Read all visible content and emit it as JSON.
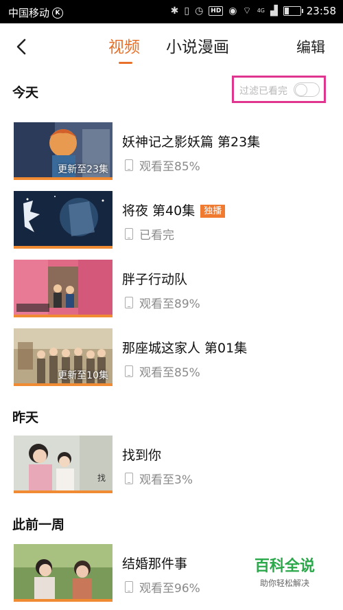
{
  "status_bar": {
    "carrier": "中国移动",
    "carrier_badge": "K",
    "network": "4G",
    "hd": "HD",
    "time": "23:58",
    "battery_level": 0.25
  },
  "header": {
    "tabs": [
      {
        "label": "视频",
        "active": true
      },
      {
        "label": "小说漫画",
        "active": false
      }
    ],
    "edit_label": "编辑",
    "accent_color": "#e8702a"
  },
  "filter": {
    "label": "过滤已看完",
    "enabled": false,
    "highlight_color": "#e0358e"
  },
  "sections": [
    {
      "title": "今天",
      "items": [
        {
          "title": "妖神记之影妖篇 第23集",
          "progress": "观看至85%",
          "thumb_caption": "更新至23集",
          "badge": ""
        },
        {
          "title": "将夜 第40集",
          "progress": "已看完",
          "thumb_caption": "",
          "badge": "独播"
        },
        {
          "title": "胖子行动队",
          "progress": "观看至89%",
          "thumb_caption": "",
          "badge": ""
        },
        {
          "title": "那座城这家人 第01集",
          "progress": "观看至85%",
          "thumb_caption": "更新至10集",
          "badge": ""
        }
      ]
    },
    {
      "title": "昨天",
      "items": [
        {
          "title": "找到你",
          "progress": "观看至3%",
          "thumb_caption": "",
          "badge": ""
        }
      ]
    },
    {
      "title": "此前一周",
      "items": [
        {
          "title": "结婚那件事",
          "progress": "观看至96%",
          "thumb_caption": "",
          "badge": ""
        }
      ]
    }
  ],
  "watermark": {
    "main": "百科全说",
    "sub": "助你轻松解决"
  }
}
